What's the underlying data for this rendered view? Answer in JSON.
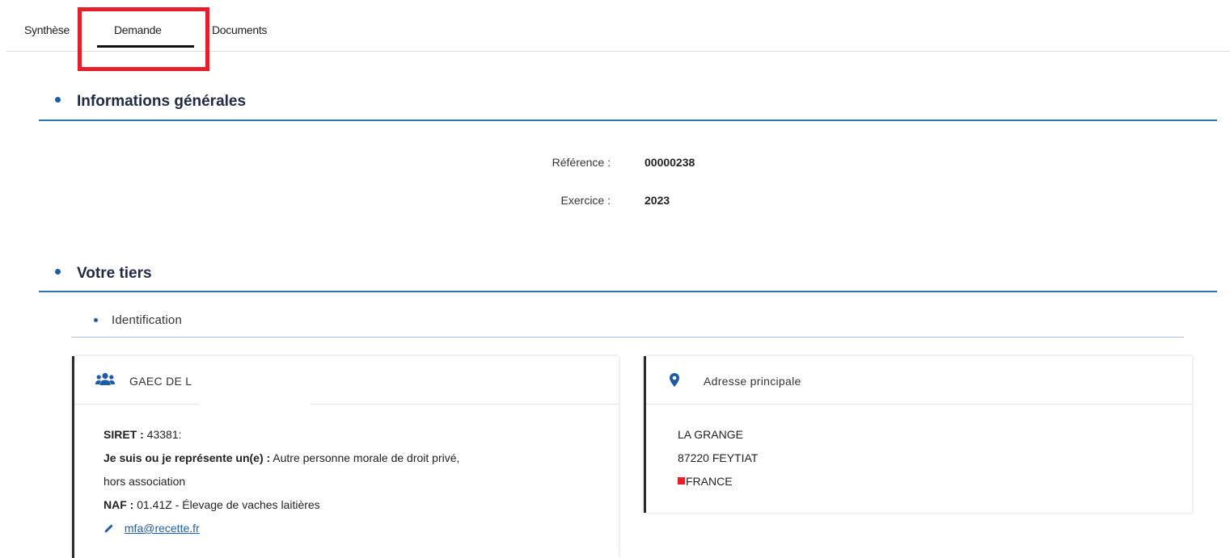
{
  "tabs": {
    "synthese": "Synthèse",
    "demande": "Demande",
    "documents": "Documents"
  },
  "sections": {
    "general": {
      "title": "Informations générales",
      "reference_label": "Référence :",
      "reference_value": "00000238",
      "exercice_label": "Exercice :",
      "exercice_value": "2023"
    },
    "tiers": {
      "title": "Votre tiers",
      "subsection": "Identification",
      "card_tiers": {
        "title": "GAEC DE L",
        "siret_label": "SIRET :",
        "siret_value": "43381:",
        "represent_label": "Je suis ou je représente un(e) :",
        "represent_value_line1": "Autre personne morale de droit privé,",
        "represent_value_line2": "hors association",
        "naf_label": "NAF :",
        "naf_value": "01.41Z - Élevage de vaches laitières",
        "email": "mfa@recette.fr"
      },
      "card_adresse": {
        "title": "Adresse principale",
        "line1": "LA GRANGE",
        "line2": "87220 FEYTIAT",
        "country": "FRANCE"
      }
    }
  },
  "colors": {
    "accent": "#1d5aa8",
    "rule": "#2f72b8",
    "highlight": "#e4212b",
    "link": "#1a5fb4"
  }
}
